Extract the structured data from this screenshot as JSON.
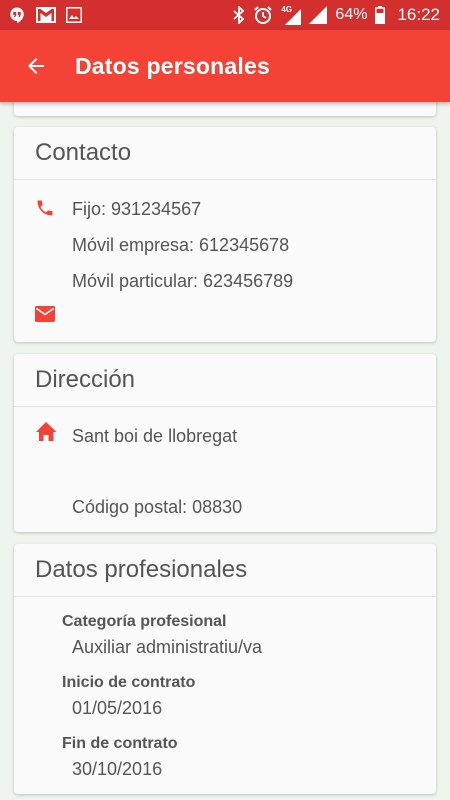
{
  "status_bar": {
    "network": "4G",
    "battery": "64%",
    "time": "16:22",
    "icons": [
      "hangouts-icon",
      "gmail-icon",
      "gallery-icon",
      "bluetooth-icon",
      "alarm-icon",
      "signal-icon",
      "battery-icon"
    ]
  },
  "app_bar": {
    "title": "Datos personales",
    "back_icon": "arrow-back-icon"
  },
  "contact": {
    "title": "Contacto",
    "fijo": "Fijo: 931234567",
    "movil_empresa": "Móvil empresa: 612345678",
    "movil_particular": "Móvil particular: 623456789",
    "phone_icon": "phone-icon",
    "email_icon": "email-icon"
  },
  "address": {
    "title": "Dirección",
    "city": "Sant boi de llobregat",
    "postal_code": "Código postal: 08830",
    "home_icon": "home-icon"
  },
  "professional": {
    "title": "Datos profesionales",
    "category_label": "Categoría profesional",
    "category_value": "Auxiliar administratiu/va",
    "start_label": "Inicio de contrato",
    "start_value": "01/05/2016",
    "end_label": "Fin de contrato",
    "end_value": "30/10/2016"
  },
  "colors": {
    "status_bar": "#d32f2f",
    "app_bar": "#f44336",
    "icon_accent": "#f44336",
    "background": "#eef5ee"
  }
}
